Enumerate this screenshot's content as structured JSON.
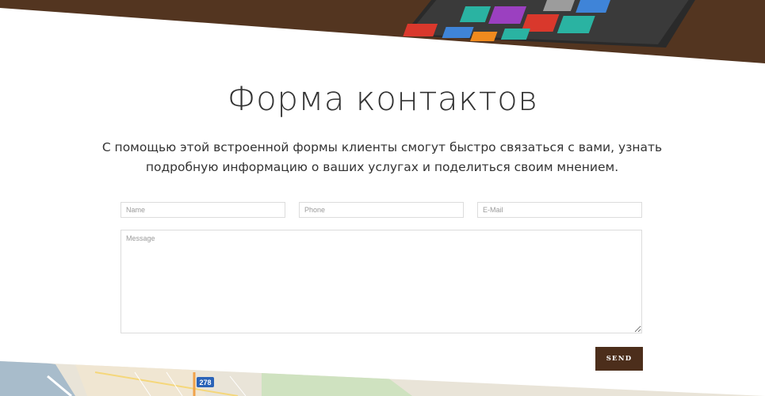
{
  "colors": {
    "top_band": "#533520",
    "send_button": "#4c2e1b",
    "title_text": "#333333"
  },
  "header": {
    "title": "Форма контактов",
    "description": "С помощью этой встроенной формы клиенты смогут быстро связаться с вами, узнать подробную информацию о ваших услугах и поделиться своим мнением."
  },
  "form": {
    "name_placeholder": "Name",
    "phone_placeholder": "Phone",
    "email_placeholder": "E-Mail",
    "message_placeholder": "Message",
    "send_label": "SEND"
  },
  "map": {
    "route_badge": "278"
  }
}
